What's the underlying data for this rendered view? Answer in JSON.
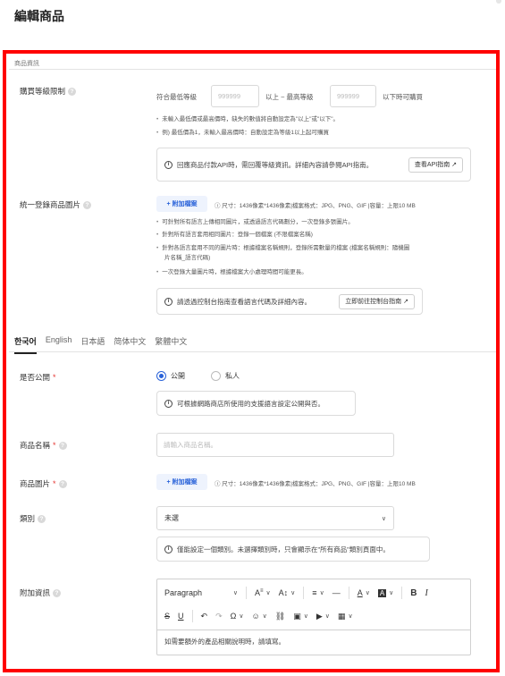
{
  "page": {
    "title": "編輯商品"
  },
  "section": {
    "label": "商品資訊"
  },
  "purchase_limit": {
    "label": "購買等級限制",
    "prefix_text": "符合最低等級",
    "min_placeholder": "999999",
    "middle_text": "以上 ~ 最高等級",
    "max_placeholder": "999999",
    "suffix_text": "以下時可購買",
    "notes": [
      "未輸入最低價或最高價時，缺失的數值將自動設定為\"以上\"或\"以下\"。",
      "例) 最低價為1，未輸入最高價時：自動設定為等級1以上起可購買"
    ],
    "info_text": "回應商品付款API時，需回覆等級資訊。詳細內容請參閱API指南。",
    "info_button": "查看API指南 ↗"
  },
  "unified_image": {
    "label": "統一登錄商品圖片",
    "attach_label": "+ 附加檔案",
    "spec_text": "ⓘ 尺寸：1436像素*1436像素|檔案格式：JPG、PNG、GIF |容量：上限10 MB",
    "notes": [
      "可針對所有語言上傳相同圖片，或透過語言代碼劃分，一次登錄多張圖片。",
      "針對所有語言套用相同圖片：登錄一個檔案 (不限檔案名稱)",
      "針對各語言套用不同的圖片時：根據檔案名稱規則，登錄所需數量的檔案 (檔案名稱規則：隨機圖",
      "片名稱_語言代碼)",
      "一次登錄大量圖片時，根據檔案大小處理時間可能更長。"
    ],
    "info_text": "請透過控制台指南查看語言代碼及詳細內容。",
    "info_button": "立即前往控制台指南 ↗"
  },
  "tabs": [
    "한국어",
    "English",
    "日本語",
    "简体中文",
    "繁體中文"
  ],
  "visibility": {
    "label": "是否公開",
    "required": "*",
    "options": [
      "公開",
      "私人"
    ],
    "info_text": "可根據網路商店所使用的支援語言設定公開與否。"
  },
  "product_name": {
    "label": "商品名稱",
    "required": "*",
    "placeholder": "請輸入商品名稱。"
  },
  "product_image": {
    "label": "商品圖片",
    "required": "*",
    "attach_label": "+ 附加檔案",
    "spec_text": "ⓘ 尺寸：1436像素*1436像素|檔案格式：JPG、PNG、GIF |容量：上限10 MB"
  },
  "category": {
    "label": "類別",
    "selected": "未選",
    "info_text": "僅能設定一個類別。未選擇類別時，只會顯示在\"所有商品\"類別頁面中。"
  },
  "additional_info": {
    "label": "附加資訊",
    "paragraph_select": "Paragraph",
    "editor_placeholder": "如需要額外的產品相關說明時，請填寫。"
  }
}
